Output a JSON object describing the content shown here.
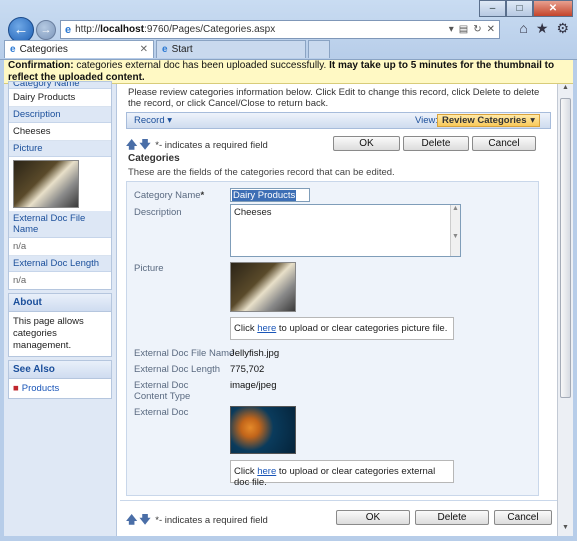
{
  "browser": {
    "url_prefix": "http://",
    "url_host": "localhost",
    "url_rest": ":9760/Pages/Categories.aspx",
    "tabs": [
      {
        "label": "Categories",
        "active": true
      },
      {
        "label": "Start",
        "active": false
      }
    ],
    "window_buttons": [
      "–",
      "□",
      "✕"
    ]
  },
  "confirmation": {
    "prefix": "Confirmation:",
    "message": " categories external doc has been uploaded successfully. ",
    "emphasis": "It may take up to 5 minutes for the thumbnail to reflect the uploaded content."
  },
  "sidebar": {
    "category_name_label": "Category Name",
    "category_name_value": "Dairy Products",
    "description_label": "Description",
    "description_value": "Cheeses",
    "picture_label": "Picture",
    "ext_doc_file_name_label": "External Doc File Name",
    "ext_doc_file_name_value": "n/a",
    "ext_doc_length_label": "External Doc Length",
    "ext_doc_length_value": "n/a",
    "about_title": "About",
    "about_text": "This page allows categories management.",
    "see_also_title": "See Also",
    "see_also_link": "Products"
  },
  "main": {
    "intro": "Please review categories information below. Click Edit to change this record, click Delete to delete the record, or click Cancel/Close to return back.",
    "record_menu": "Record",
    "view_label": "View:",
    "view_value": "Review Categories",
    "required_note": " - indicates a required field",
    "ok_label": "OK",
    "delete_label": "Delete",
    "cancel_label": "Cancel",
    "section_title": "Categories",
    "section_desc": "These are the fields of the categories record that can be edited.",
    "fields": {
      "category_name_label": "Category Name",
      "category_name_value": "Dairy Products",
      "description_label": "Description",
      "description_value": "Cheeses",
      "picture_label": "Picture",
      "picture_upload_pre": "Click ",
      "picture_upload_link": "here",
      "picture_upload_post": " to upload or clear categories picture file.",
      "ext_doc_file_name_label": "External Doc File Name",
      "ext_doc_file_name_value": "Jellyfish.jpg",
      "ext_doc_length_label": "External Doc Length",
      "ext_doc_length_value": "775,702",
      "ext_doc_content_type_label": "External Doc Content Type",
      "ext_doc_content_type_value": "image/jpeg",
      "ext_doc_label": "External Doc",
      "doc_upload_pre": "Click ",
      "doc_upload_link": "here",
      "doc_upload_post": " to upload or clear categories external doc file."
    }
  }
}
